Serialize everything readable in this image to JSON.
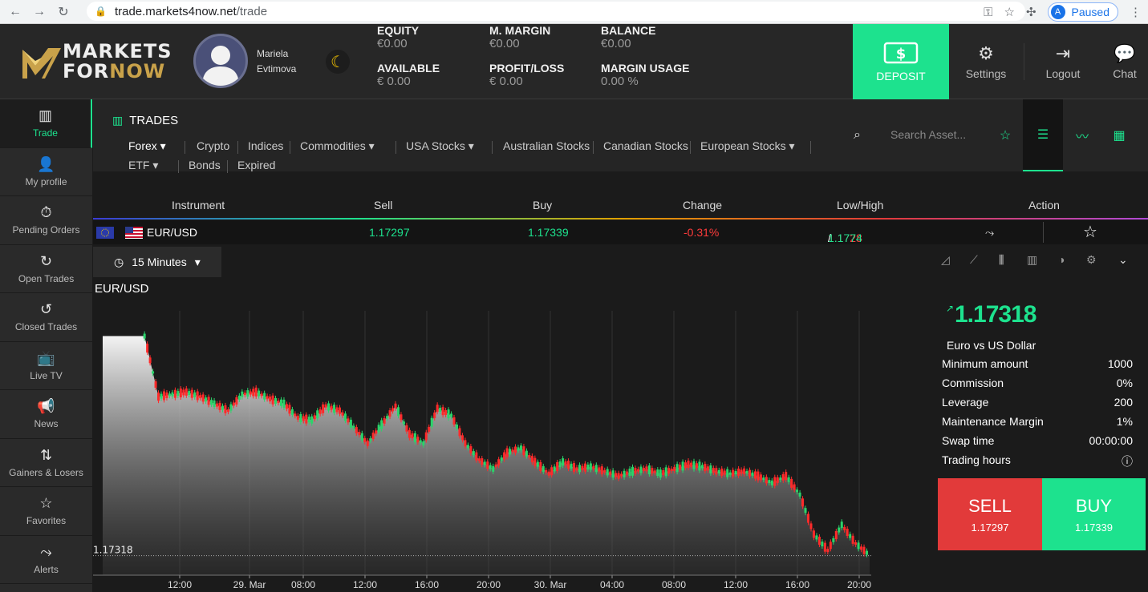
{
  "browser": {
    "url_host": "trade.markets4now.net",
    "url_path": "/trade",
    "profile_initial": "A",
    "profile_status": "Paused"
  },
  "header": {
    "logo_line1": "MARKETS",
    "logo_line2_a": "FOR",
    "logo_line2_b": "NOW",
    "user_first": "Mariela",
    "user_last": "Evtimova",
    "stats": [
      {
        "label": "EQUITY",
        "value": "€0.00"
      },
      {
        "label": "M. MARGIN",
        "value": "€0.00"
      },
      {
        "label": "BALANCE",
        "value": "€0.00"
      },
      {
        "label": "AVAILABLE",
        "value": "€ 0.00"
      },
      {
        "label": "PROFIT/LOSS",
        "value": "€ 0.00"
      },
      {
        "label": "MARGIN USAGE",
        "value": "0.00 %"
      }
    ],
    "deposit_label": "DEPOSIT",
    "settings_label": "Settings",
    "logout_label": "Logout",
    "chat_label": "Chat"
  },
  "sidebar": {
    "items": [
      {
        "label": "Trade",
        "icon": "chart-bars-icon"
      },
      {
        "label": "My profile",
        "icon": "user-icon"
      },
      {
        "label": "Pending Orders",
        "icon": "stopwatch-icon"
      },
      {
        "label": "Open Trades",
        "icon": "open-trades-icon"
      },
      {
        "label": "Closed Trades",
        "icon": "closed-trades-icon"
      },
      {
        "label": "Live TV",
        "icon": "tv-icon"
      },
      {
        "label": "News",
        "icon": "megaphone-icon"
      },
      {
        "label": "Gainers & Losers",
        "icon": "gainers-icon"
      },
      {
        "label": "Favorites",
        "icon": "star-icon"
      },
      {
        "label": "Alerts",
        "icon": "alert-icon"
      }
    ]
  },
  "trades": {
    "title": "TRADES",
    "categories": [
      "Forex",
      "Crypto",
      "Indices",
      "Commodities",
      "USA Stocks",
      "Australian Stocks",
      "Canadian Stocks",
      "European Stocks",
      "ETF",
      "Bonds",
      "Expired"
    ],
    "search_placeholder": "Search Asset..."
  },
  "table": {
    "headers": [
      "Instrument",
      "Sell",
      "Buy",
      "Change",
      "Low/High",
      "Action"
    ],
    "row": {
      "instrument": "EUR/USD",
      "sell": "1.17297",
      "buy": "1.17339",
      "change": "-0.31%",
      "low": "1.1728",
      "slash": " / ",
      "high": "1.1774"
    }
  },
  "chart_toolbar": {
    "interval": "15 Minutes"
  },
  "chart_data": {
    "type": "candlestick",
    "title": "EUR/USD",
    "current_price_label": "1.17318",
    "y_ticks": [
      "1.183",
      "1.1825",
      "1.182",
      "1.1815",
      "1.181",
      "1.1805",
      "1.18",
      "1.1795",
      "1.179",
      "1.1785",
      "1.178",
      "1.1775",
      "1.177",
      "1.1765",
      "1.176",
      "1.1755",
      "1.175",
      "1.1745",
      "1.174",
      "1.1735",
      "1.173",
      "1.1725",
      "1.172"
    ],
    "x_ticks": [
      "12:00",
      "29. Mar",
      "08:00",
      "12:00",
      "16:00",
      "20:00",
      "30. Mar",
      "04:00",
      "08:00",
      "12:00",
      "16:00",
      "20:00"
    ],
    "ylim": [
      1.172,
      1.183
    ],
    "series": [
      {
        "name": "EUR/USD",
        "values": [
          1.1825,
          1.1825,
          1.1825,
          1.1825,
          1.1799,
          1.18,
          1.1801,
          1.1799,
          1.1796,
          1.1793,
          1.18,
          1.1801,
          1.1798,
          1.1796,
          1.179,
          1.1789,
          1.1795,
          1.1793,
          1.1786,
          1.1779,
          1.1787,
          1.1795,
          1.1783,
          1.1779,
          1.1794,
          1.1791,
          1.1779,
          1.1772,
          1.1768,
          1.1775,
          1.1777,
          1.1771,
          1.1766,
          1.1771,
          1.1768,
          1.1769,
          1.1767,
          1.1765,
          1.1767,
          1.1768,
          1.1766,
          1.1768,
          1.177,
          1.1769,
          1.1767,
          1.1766,
          1.1767,
          1.1765,
          1.1762,
          1.1765,
          1.1757,
          1.174,
          1.1733,
          1.1744,
          1.1736,
          1.1731
        ]
      }
    ]
  },
  "asset_info": {
    "price": "1.17318",
    "name": "Euro vs US Dollar",
    "rows": [
      {
        "label": "Minimum amount",
        "value": "1000"
      },
      {
        "label": "Commission",
        "value": "0%"
      },
      {
        "label": "Leverage",
        "value": "200"
      },
      {
        "label": "Maintenance Margin",
        "value": "1%"
      },
      {
        "label": "Swap time",
        "value": "00:00:00"
      },
      {
        "label": "Trading hours",
        "value": "ⓘ"
      }
    ],
    "sell_label": "SELL",
    "sell_price": "1.17297",
    "buy_label": "BUY",
    "buy_price": "1.17339"
  },
  "colors": {
    "accent": "#1de28e",
    "sell": "#e23a3a",
    "background": "#1b1b1b"
  }
}
